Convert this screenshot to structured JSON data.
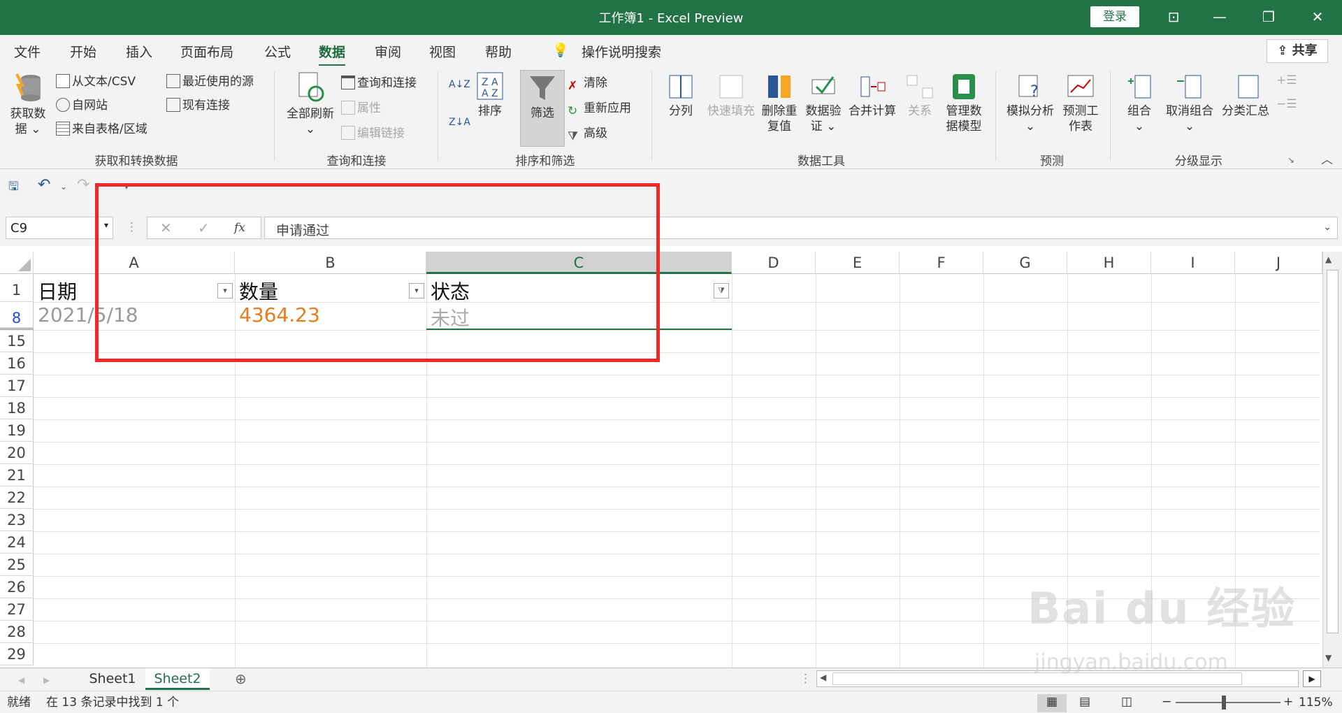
{
  "window": {
    "title": "工作簿1 - Excel Preview",
    "login": "登录",
    "share": "共享"
  },
  "tabs": [
    "文件",
    "开始",
    "插入",
    "页面布局",
    "公式",
    "数据",
    "审阅",
    "视图",
    "帮助",
    "操作说明搜索"
  ],
  "ribbon": {
    "get_data": "获取数据",
    "from_text": "从文本/CSV",
    "from_web": "自网站",
    "from_table": "来自表格/区域",
    "recent": "最近使用的源",
    "existing": "现有连接",
    "grp1": "获取和转换数据",
    "refresh_all": "全部刷新",
    "queries": "查询和连接",
    "properties": "属性",
    "edit_links": "编辑链接",
    "grp2": "查询和连接",
    "sort": "排序",
    "filter": "筛选",
    "clear": "清除",
    "reapply": "重新应用",
    "advanced": "高级",
    "grp3": "排序和筛选",
    "split": "分列",
    "flash": "快速填充",
    "remove_dup": "删除重复值",
    "validation": "数据验证",
    "consolidate": "合并计算",
    "relations": "关系",
    "data_model": "管理数据模型",
    "grp4": "数据工具",
    "whatif": "模拟分析",
    "forecast": "预测工作表",
    "grp5": "预测",
    "group": "组合",
    "ungroup": "取消组合",
    "subtotal": "分类汇总",
    "grp6": "分级显示"
  },
  "formula": {
    "namebox": "C9",
    "fx": "fx",
    "content": "申请通过"
  },
  "columns": [
    "A",
    "B",
    "C",
    "D",
    "E",
    "F",
    "G",
    "H",
    "I",
    "J"
  ],
  "rows": [
    "1",
    "8",
    "15",
    "16",
    "17",
    "18",
    "19",
    "20",
    "21",
    "22",
    "23",
    "24",
    "25",
    "26",
    "27",
    "28",
    "29"
  ],
  "cells": {
    "a1": "日期",
    "b1": "数量",
    "c1": "状态",
    "a8": "2021/5/18",
    "b8": "4364.23",
    "c8": "未过"
  },
  "sheets": [
    "Sheet1",
    "Sheet2"
  ],
  "status": {
    "ready": "就绪",
    "found": "在 13 条记录中找到 1 个",
    "zoom": "115%"
  },
  "colors": {
    "accent": "#217346",
    "highlight": "#f02a2a",
    "number": "#e87c1e"
  },
  "watermark": {
    "logo": "Bai du 经验",
    "url": "jingyan.baidu.com"
  }
}
